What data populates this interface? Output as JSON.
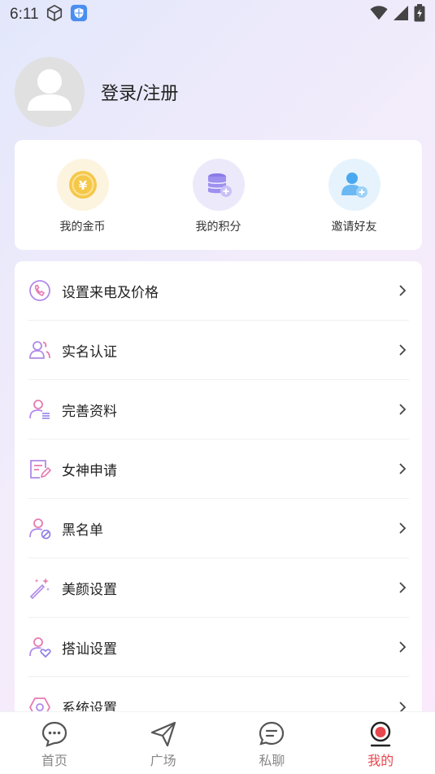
{
  "status": {
    "time": "6:11"
  },
  "profile": {
    "login_text": "登录/注册"
  },
  "stats": [
    {
      "label": "我的金币",
      "icon": "coin-icon",
      "color": "#f5c84a"
    },
    {
      "label": "我的积分",
      "icon": "points-database-icon",
      "color": "#8a7be8"
    },
    {
      "label": "邀请好友",
      "icon": "invite-friend-icon",
      "color": "#4aa8f0"
    }
  ],
  "menu": {
    "items": [
      {
        "label": "设置来电及价格",
        "icon": "phone-price-icon"
      },
      {
        "label": "实名认证",
        "icon": "realname-auth-icon"
      },
      {
        "label": "完善资料",
        "icon": "profile-edit-icon"
      },
      {
        "label": "女神申请",
        "icon": "application-form-icon"
      },
      {
        "label": "黑名单",
        "icon": "blacklist-icon"
      },
      {
        "label": "美颜设置",
        "icon": "beauty-wand-icon"
      },
      {
        "label": "搭讪设置",
        "icon": "greeting-heart-icon"
      },
      {
        "label": "系统设置",
        "icon": "system-settings-icon"
      }
    ]
  },
  "tabbar": {
    "tabs": [
      {
        "label": "首页",
        "icon": "home-chat-icon"
      },
      {
        "label": "广场",
        "icon": "square-send-icon"
      },
      {
        "label": "私聊",
        "icon": "private-chat-icon"
      },
      {
        "label": "我的",
        "icon": "me-icon"
      }
    ],
    "active_color": "#e8474f"
  }
}
